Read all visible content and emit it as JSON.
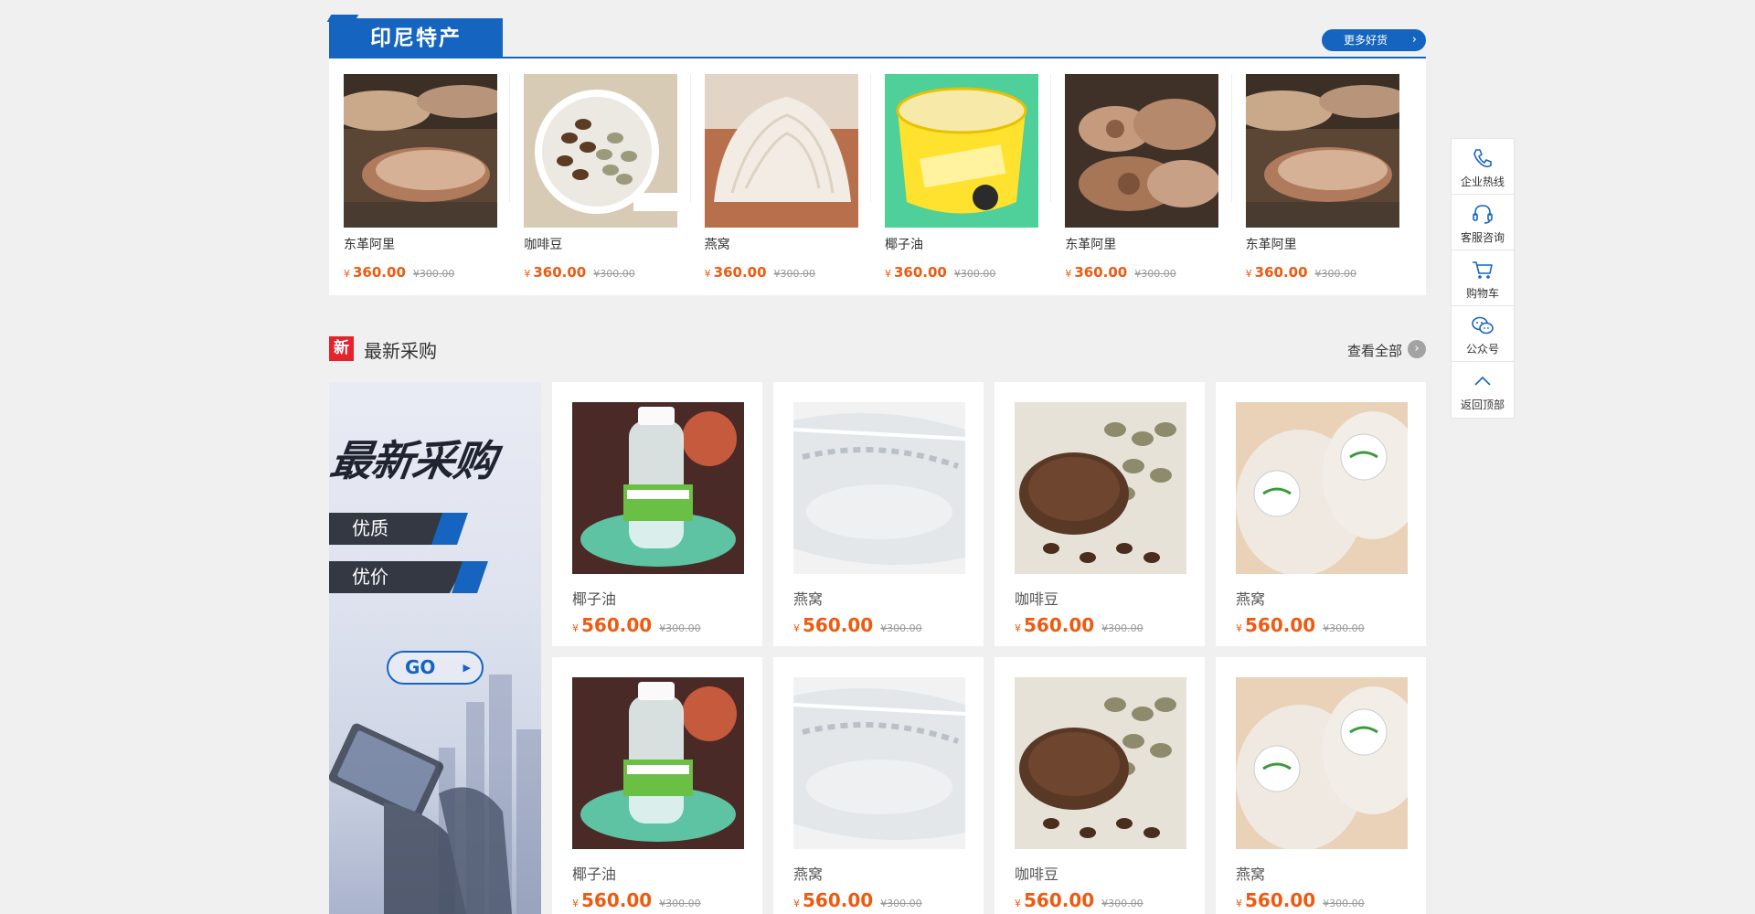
{
  "featured": {
    "title": "印尼特产",
    "more_label": "更多好货",
    "items": [
      {
        "name": "东革阿里",
        "currency": "¥",
        "price": "360.00",
        "old_price": "¥300.00",
        "image": "sliced-root"
      },
      {
        "name": "咖啡豆",
        "currency": "¥",
        "price": "360.00",
        "old_price": "¥300.00",
        "image": "coffee-beans"
      },
      {
        "name": "燕窝",
        "currency": "¥",
        "price": "360.00",
        "old_price": "¥300.00",
        "image": "birds-nest"
      },
      {
        "name": "椰子油",
        "currency": "¥",
        "price": "360.00",
        "old_price": "¥300.00",
        "image": "coconut-oil-tub"
      },
      {
        "name": "东革阿里",
        "currency": "¥",
        "price": "360.00",
        "old_price": "¥300.00",
        "image": "sliced-root"
      },
      {
        "name": "东革阿里",
        "currency": "¥",
        "price": "360.00",
        "old_price": "¥300.00",
        "image": "sliced-root"
      }
    ]
  },
  "latest": {
    "badge": "新",
    "title": "最新采购",
    "view_all_label": "查看全部",
    "banner": {
      "title": "最新采购",
      "tags": [
        "优质",
        "优价"
      ],
      "go_label": "GO"
    },
    "items": [
      {
        "name": "椰子油",
        "currency": "¥",
        "price": "560.00",
        "old_price": "¥300.00",
        "image": "coconut-oil-bottle"
      },
      {
        "name": "燕窝",
        "currency": "¥",
        "price": "560.00",
        "old_price": "¥300.00",
        "image": "birds-nest-white"
      },
      {
        "name": "咖啡豆",
        "currency": "¥",
        "price": "560.00",
        "old_price": "¥300.00",
        "image": "coffee-grounds"
      },
      {
        "name": "燕窝",
        "currency": "¥",
        "price": "560.00",
        "old_price": "¥300.00",
        "image": "birds-nest-packed"
      },
      {
        "name": "椰子油",
        "currency": "¥",
        "price": "560.00",
        "old_price": "¥300.00",
        "image": "coconut-oil-bottle"
      },
      {
        "name": "燕窝",
        "currency": "¥",
        "price": "560.00",
        "old_price": "¥300.00",
        "image": "birds-nest-white"
      },
      {
        "name": "咖啡豆",
        "currency": "¥",
        "price": "560.00",
        "old_price": "¥300.00",
        "image": "coffee-grounds"
      },
      {
        "name": "燕窝",
        "currency": "¥",
        "price": "560.00",
        "old_price": "¥300.00",
        "image": "birds-nest-packed"
      }
    ]
  },
  "side": [
    {
      "label": "企业热线",
      "icon": "phone-icon"
    },
    {
      "label": "客服咨询",
      "icon": "headset-icon"
    },
    {
      "label": "购物车",
      "icon": "cart-icon"
    },
    {
      "label": "公众号",
      "icon": "wechat-icon"
    },
    {
      "label": "返回顶部",
      "icon": "chevron-up-icon"
    }
  ],
  "colors": {
    "brand_blue": "#1565c0",
    "price_orange": "#ef5a0f",
    "badge_red": "#e6222d"
  }
}
